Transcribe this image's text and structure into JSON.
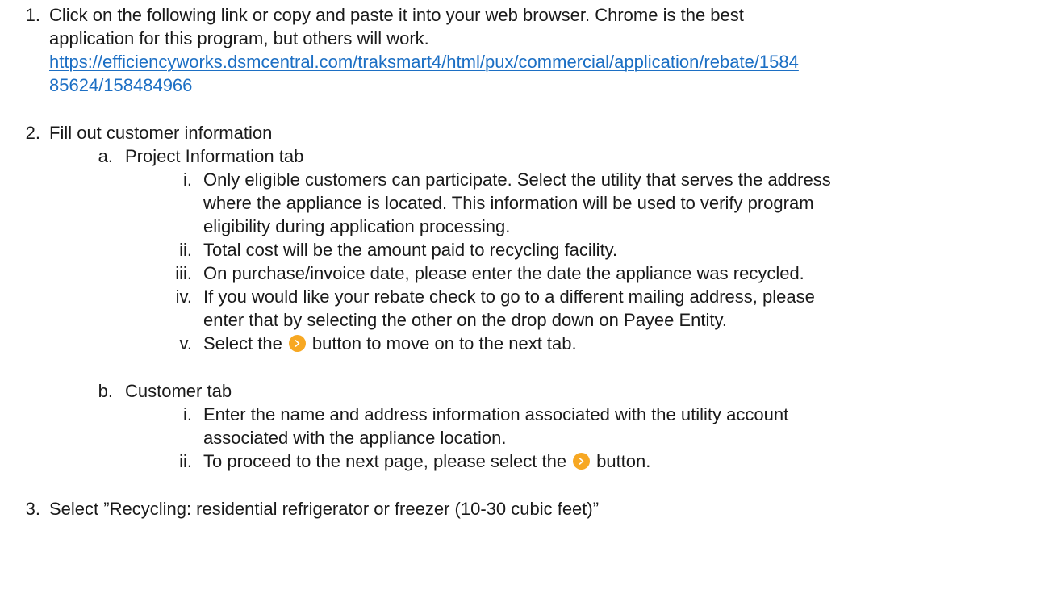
{
  "step1": {
    "number": "1.",
    "line1": "Click on the following link or copy and paste it into your web browser. Chrome is the best",
    "line2": "application for this program, but others will work.",
    "link_line1": "https://efficiencyworks.dsmcentral.com/traksmart4/html/pux/commercial/application/rebate/1584",
    "link_line2": "85624/158484966"
  },
  "step2": {
    "number": "2.",
    "text": "Fill out customer information",
    "a": {
      "label": "a.",
      "text": "Project Information tab",
      "items": [
        {
          "label": "i.",
          "lines": [
            "Only eligible customers can participate. Select the utility that serves the address",
            "where the appliance is located. This information will be used to verify program",
            "eligibility during application processing."
          ]
        },
        {
          "label": "ii.",
          "lines": [
            "Total cost will be the amount paid to recycling facility."
          ]
        },
        {
          "label": "iii.",
          "lines": [
            "On purchase/invoice date, please enter the date the appliance was recycled."
          ]
        },
        {
          "label": "iv.",
          "lines": [
            "If you would like your rebate check to go to a different mailing address, please",
            "enter that by selecting the other on the drop down on Payee Entity."
          ]
        },
        {
          "label": "v.",
          "before": "Select the",
          "after": "button to move on to the next tab."
        }
      ]
    },
    "b": {
      "label": "b.",
      "text": "Customer tab",
      "items": [
        {
          "label": "i.",
          "lines": [
            "Enter the name and address information associated with the utility account",
            "associated with the appliance location."
          ]
        },
        {
          "label": "ii.",
          "before": "To proceed to the next page, please select the",
          "after": "button."
        }
      ]
    }
  },
  "step3": {
    "number": "3.",
    "text": "Select ”Recycling: residential refrigerator or freezer (10-30 cubic feet)”"
  },
  "colors": {
    "text": "#1a1a1a",
    "link": "#1c6fc4",
    "button": "#f7a823"
  },
  "icons": {
    "next": "chevron-right-icon"
  }
}
